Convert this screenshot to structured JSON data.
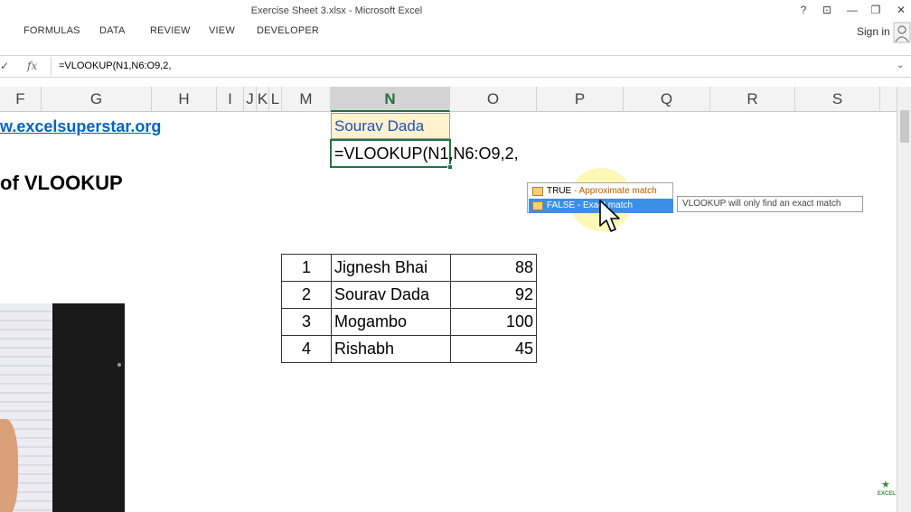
{
  "window": {
    "title": "Exercise Sheet 3.xlsx - Microsoft Excel",
    "help_glyph": "?",
    "ribbon_options_glyph": "⊡",
    "minimize_glyph": "—",
    "restore_glyph": "❐",
    "close_glyph": "✕"
  },
  "ribbon": {
    "tabs": [
      "FORMULAS",
      "DATA",
      "REVIEW",
      "VIEW",
      "DEVELOPER"
    ],
    "signin_label": "Sign in"
  },
  "formula_bar": {
    "enter_glyph": "✓",
    "fx_label": "fx",
    "value": "=VLOOKUP(N1,N6:O9,2,",
    "expand_glyph": "⌄"
  },
  "columns": [
    "F",
    "G",
    "H",
    "I",
    "J",
    "K",
    "L",
    "M",
    "N",
    "O",
    "P",
    "Q",
    "R",
    "S"
  ],
  "active_column": "N",
  "sheet": {
    "link_text": "w.excelsuperstar.org",
    "heading_text": "of VLOOKUP",
    "n1_value": "Sourav Dada",
    "n2_editing_value": "=VLOOKUP(N1,N6:O9,2,",
    "table_rows": [
      {
        "num": "1",
        "name": "Jignesh Bhai",
        "score": "88"
      },
      {
        "num": "2",
        "name": "Sourav Dada",
        "score": "92"
      },
      {
        "num": "3",
        "name": "Mogambo",
        "score": "100"
      },
      {
        "num": "4",
        "name": "Rishabh",
        "score": "45"
      }
    ]
  },
  "autocomplete": {
    "true_label": "TRUE",
    "true_desc": " - Approximate match",
    "false_label": "FALSE - Exact match",
    "tooltip": "VLOOKUP will only find an exact match"
  },
  "logo": {
    "text": "EXCEL"
  },
  "colors": {
    "excel_green": "#217346",
    "link_blue": "#0563c1",
    "selection_blue": "#3d8fe5",
    "cell_highlight": "#fff2cc"
  }
}
